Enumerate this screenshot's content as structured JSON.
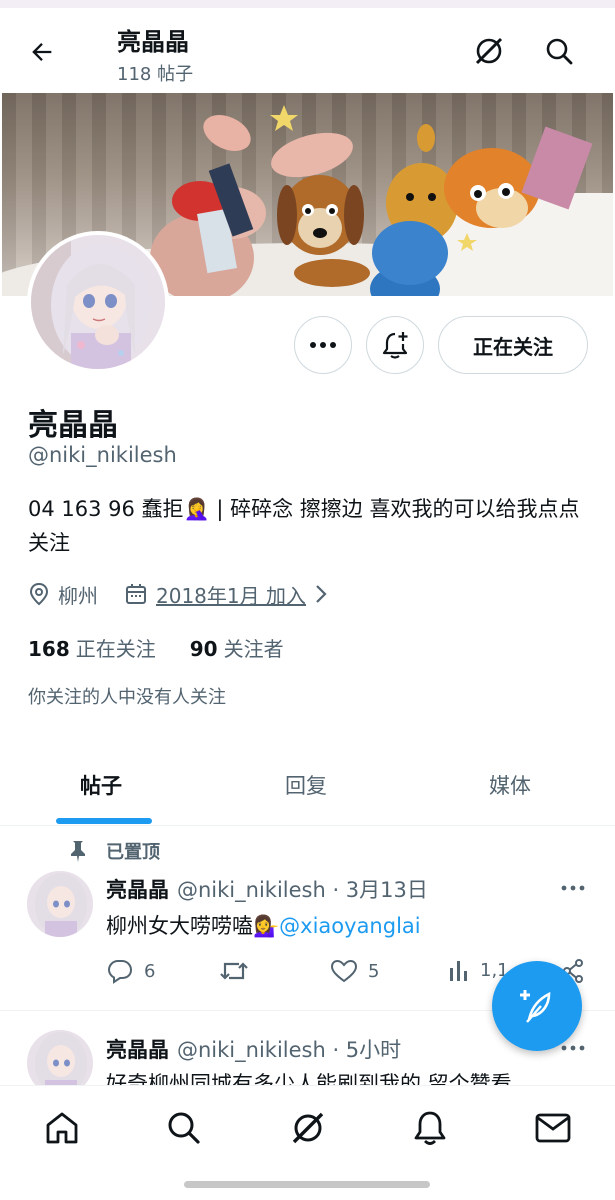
{
  "header": {
    "title": "亮晶晶",
    "post_count": "118 帖子"
  },
  "profile": {
    "name": "亮晶晶",
    "handle": "@niki_nikilesh",
    "bio": "04 163 96 蠢拒🤦‍♀️ | 碎碎念 擦擦边 喜欢我的可以给我点点关注",
    "location": "柳州",
    "joined": "2018年1月 加入",
    "following_count": "168",
    "following_label": "正在关注",
    "followers_count": "90",
    "followers_label": "关注者",
    "no_mutual": "你关注的人中没有人关注"
  },
  "buttons": {
    "follow": "正在关注"
  },
  "tabs": [
    {
      "label": "帖子",
      "active": true
    },
    {
      "label": "回复",
      "active": false
    },
    {
      "label": "媒体",
      "active": false
    }
  ],
  "posts": [
    {
      "pinned_label": "已置顶",
      "name": "亮晶晶",
      "handle": "@niki_nikilesh · 3月13日",
      "text": "柳州女大唠唠嗑💁‍♀️",
      "mention": "@xiaoyanglai",
      "replies": "6",
      "likes": "5",
      "views": "1,1"
    },
    {
      "name": "亮晶晶",
      "handle": "@niki_nikilesh · 5小时",
      "text": "好奇柳州同城有多少人能刷到我的 留个赞看"
    }
  ],
  "colors": {
    "accent": "#1d9bf0",
    "text": "#0f1419",
    "secondary": "#536471",
    "border": "#cfd9de"
  },
  "icons": {
    "back": "arrow-left-icon",
    "grok": "grok-icon",
    "search": "search-icon",
    "more": "more-horizontal-icon",
    "notify": "bell-plus-icon",
    "location": "location-pin-icon",
    "calendar": "calendar-icon",
    "chevron": "chevron-right-icon",
    "pin": "pin-icon",
    "reply": "reply-icon",
    "retweet": "retweet-icon",
    "like": "heart-icon",
    "views": "bar-chart-icon",
    "share": "share-icon",
    "compose": "compose-feather-icon",
    "home": "home-icon",
    "bell": "bell-icon",
    "mail": "mail-icon"
  }
}
